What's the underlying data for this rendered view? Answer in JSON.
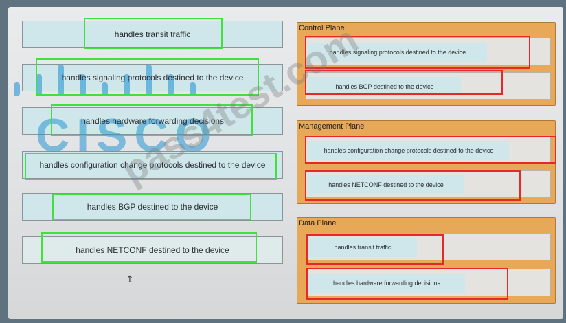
{
  "source_items": [
    "handles transit traffic",
    "handles signaling protocols destined to the device",
    "handles hardware forwarding decisions",
    "handles configuration change protocols destined to the device",
    "handles BGP destined to the device",
    "handles NETCONF destined to the device"
  ],
  "panels": [
    {
      "title": "Control Plane",
      "slots": [
        "handles signaling protocols destined to the device",
        "handles BGP destined to the device"
      ]
    },
    {
      "title": "Management Plane",
      "slots": [
        "handles configuration change protocols destined to the device",
        "handles NETCONF destined to the device"
      ]
    },
    {
      "title": "Data Plane",
      "slots": [
        "handles transit traffic",
        "handles hardware forwarding decisions"
      ]
    }
  ],
  "logo": {
    "word": "CISCO",
    "color": "#2896d2"
  },
  "watermark": "pass4test.com",
  "colors": {
    "source_fill": "#cfe7ea",
    "panel_fill": "#e7a958",
    "highlight_source": "#3fe040",
    "highlight_target": "#e52929"
  }
}
